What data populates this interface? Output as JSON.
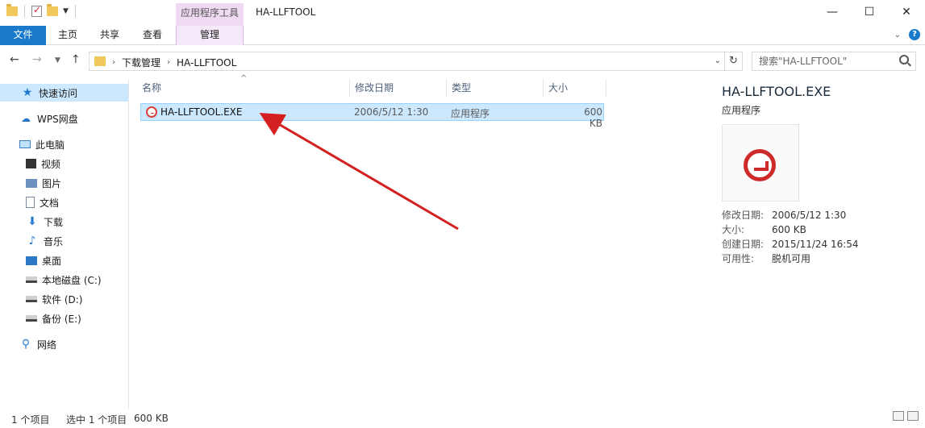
{
  "window": {
    "context_tab": "应用程序工具",
    "title": "HA-LLFTOOL",
    "minimize": "—",
    "maximize": "☐",
    "close": "✕"
  },
  "ribbon": {
    "tabs": [
      "文件",
      "主页",
      "共享",
      "查看",
      "管理"
    ],
    "accent_color": "#1979ca",
    "context_color": "#efd9f3"
  },
  "address": {
    "crumbs": [
      "下载管理",
      "HA-LLFTOOL"
    ],
    "search_placeholder": "搜索\"HA-LLFTOOL\""
  },
  "nav": {
    "items": [
      {
        "label": "快速访问",
        "icon": "star-icon"
      },
      {
        "label": "WPS网盘",
        "icon": "cloud-icon"
      },
      {
        "label": "此电脑",
        "icon": "computer-icon"
      },
      {
        "label": "视频",
        "icon": "video-icon"
      },
      {
        "label": "图片",
        "icon": "pictures-icon"
      },
      {
        "label": "文档",
        "icon": "documents-icon"
      },
      {
        "label": "下载",
        "icon": "download-icon"
      },
      {
        "label": "音乐",
        "icon": "music-icon"
      },
      {
        "label": "桌面",
        "icon": "desktop-icon"
      },
      {
        "label": "本地磁盘 (C:)",
        "icon": "drive-icon"
      },
      {
        "label": "软件 (D:)",
        "icon": "drive-icon"
      },
      {
        "label": "备份 (E:)",
        "icon": "drive-icon"
      },
      {
        "label": "网络",
        "icon": "network-icon"
      }
    ]
  },
  "filelist": {
    "columns": [
      "名称",
      "修改日期",
      "类型",
      "大小"
    ],
    "rows": [
      {
        "name": "HA-LLFTOOL.EXE",
        "date": "2006/5/12 1:30",
        "type": "应用程序",
        "size": "600 KB"
      }
    ]
  },
  "preview": {
    "title": "HA-LLFTOOL.EXE",
    "type": "应用程序",
    "props": [
      {
        "k": "修改日期:",
        "v": "2006/5/12 1:30"
      },
      {
        "k": "大小:",
        "v": "600 KB"
      },
      {
        "k": "创建日期:",
        "v": "2015/11/24 16:54"
      },
      {
        "k": "可用性:",
        "v": "脱机可用"
      }
    ]
  },
  "status": {
    "items_count": "1 个项目",
    "selected": "选中 1 个项目",
    "selected_size": "600 KB"
  },
  "annotation": {
    "arrow_color": "#d42020"
  }
}
